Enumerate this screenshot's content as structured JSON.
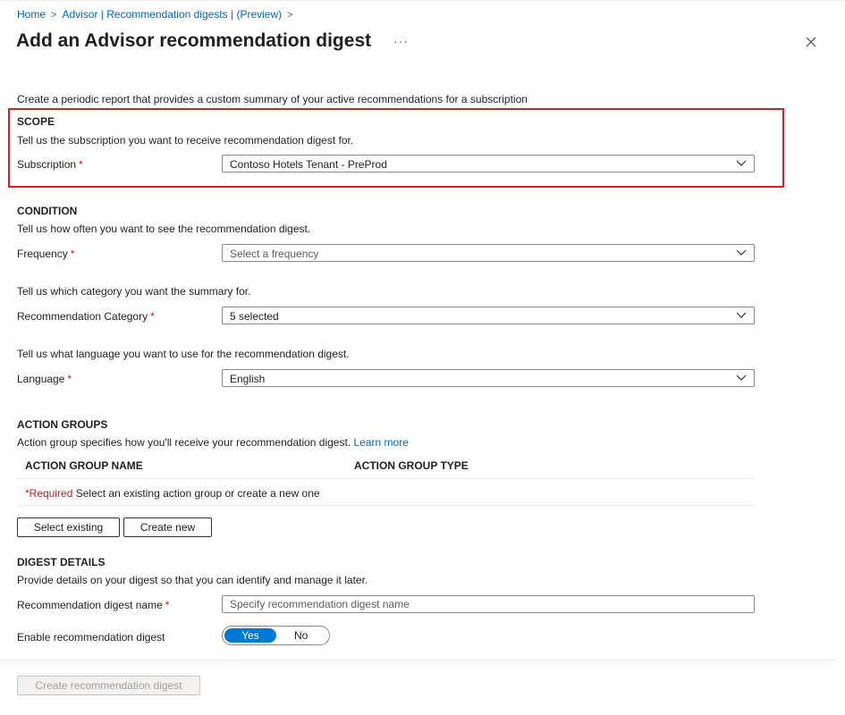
{
  "breadcrumb": {
    "home": "Home",
    "advisor": "Advisor | Recommendation digests | (Preview)",
    "sep": ">"
  },
  "header": {
    "title": "Add an Advisor recommendation digest",
    "more": "···"
  },
  "description": "Create a periodic report that provides a custom summary of your active recommendations for a subscription",
  "scope": {
    "heading": "SCOPE",
    "text": "Tell us the subscription you want to receive recommendation digest for.",
    "subscription_label": "Subscription",
    "subscription_value": "Contoso Hotels Tenant - PreProd"
  },
  "condition": {
    "heading": "CONDITION",
    "frequency_text": "Tell us how often you want to see the recommendation digest.",
    "frequency_label": "Frequency",
    "frequency_placeholder": "Select a frequency",
    "category_text": "Tell us which category you want the summary for.",
    "category_label": "Recommendation Category",
    "category_value": "5 selected",
    "language_text": "Tell us what language you want to use for the recommendation digest.",
    "language_label": "Language",
    "language_value": "English"
  },
  "action_groups": {
    "heading": "ACTION GROUPS",
    "text": "Action group specifies how you'll receive your recommendation digest.",
    "learn_more": "Learn more",
    "columns": [
      "ACTION GROUP NAME",
      "ACTION GROUP TYPE"
    ],
    "required_marker": "*Required",
    "required_text": "Select an existing action group or create a new one",
    "select_existing": "Select existing",
    "create_new": "Create new"
  },
  "digest_details": {
    "heading": "DIGEST DETAILS",
    "text": "Provide details on your digest so that you can identify and manage it later.",
    "name_label": "Recommendation digest name",
    "name_placeholder": "Specify recommendation digest name",
    "enable_label": "Enable recommendation digest",
    "toggle_yes": "Yes",
    "toggle_no": "No"
  },
  "footer": {
    "create_button": "Create recommendation digest"
  },
  "required_star": "*",
  "colors": {
    "accent": "#0078d4",
    "link": "#0067b8",
    "required": "#a4262c",
    "highlight_border": "#d31f26"
  }
}
